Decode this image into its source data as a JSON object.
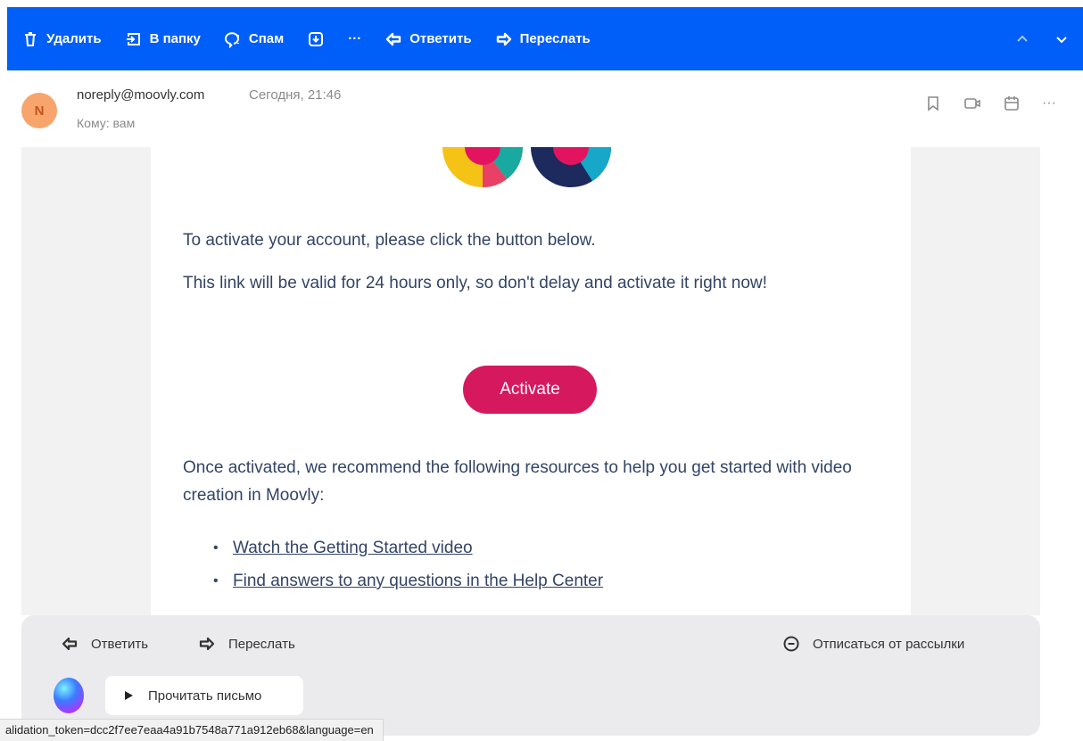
{
  "toolbar": {
    "delete_label": "Удалить",
    "move_label": "В папку",
    "spam_label": "Спам",
    "more_label": "···",
    "reply_label": "Ответить",
    "forward_label": "Переслать"
  },
  "header": {
    "avatar_letter": "N",
    "sender_email": "noreply@moovly.com",
    "date": "Сегодня, 21:46",
    "recipient": "Кому: вам",
    "more_label": "···"
  },
  "email": {
    "para1": "To activate your account, please click the button below.",
    "para2": "This link will be valid for 24 hours only, so don't delay and activate it right now!",
    "activate_label": "Activate",
    "para3": "Once activated, we recommend the following resources to help you get started with video creation in Moovly:",
    "links": [
      "Watch the Getting Started video",
      "Find answers to any questions in the Help Center"
    ]
  },
  "footer": {
    "reply_label": "Ответить",
    "forward_label": "Переслать",
    "unsubscribe_label": "Отписаться от рассылки",
    "read_letter_label": "Прочитать письмо"
  },
  "status_bar": {
    "url": "alidation_token=dcc2f7ee7eaa4a91b7548a771a912eb68&language=en"
  },
  "colors": {
    "toolbar_bg": "#005ff9",
    "activate_button": "#d6195f",
    "avatar_bg": "#f7a56c",
    "text": "#334466"
  }
}
